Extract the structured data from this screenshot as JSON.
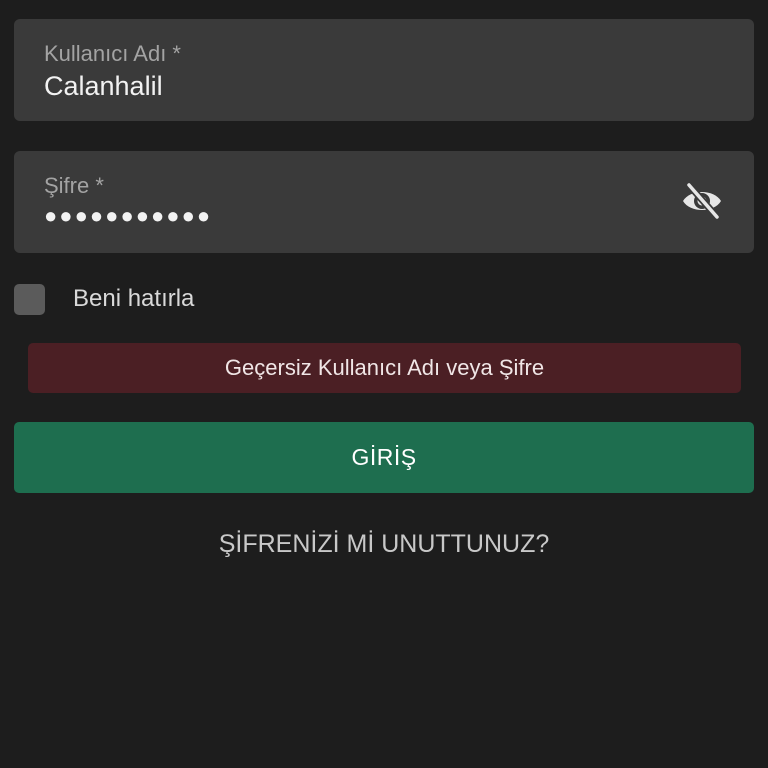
{
  "username_field": {
    "label": "Kullanıcı Adı *",
    "value": "Calanhalil"
  },
  "password_field": {
    "label": "Şifre *",
    "masked_value": "●●●●●●●●●●●",
    "toggle_icon": "eye-off-icon"
  },
  "remember_me": {
    "label": "Beni hatırla",
    "checked": false
  },
  "error_message": "Geçersiz Kullanıcı Adı veya Şifre",
  "login_button": {
    "label": "GİRİŞ"
  },
  "forgot_password_link": "ŞİFRENİZİ Mİ UNUTTUNUZ?",
  "colors": {
    "background": "#1d1d1d",
    "field_background": "#3a3a3a",
    "error_background": "#4b1f24",
    "primary_button": "#1e6e4f"
  }
}
